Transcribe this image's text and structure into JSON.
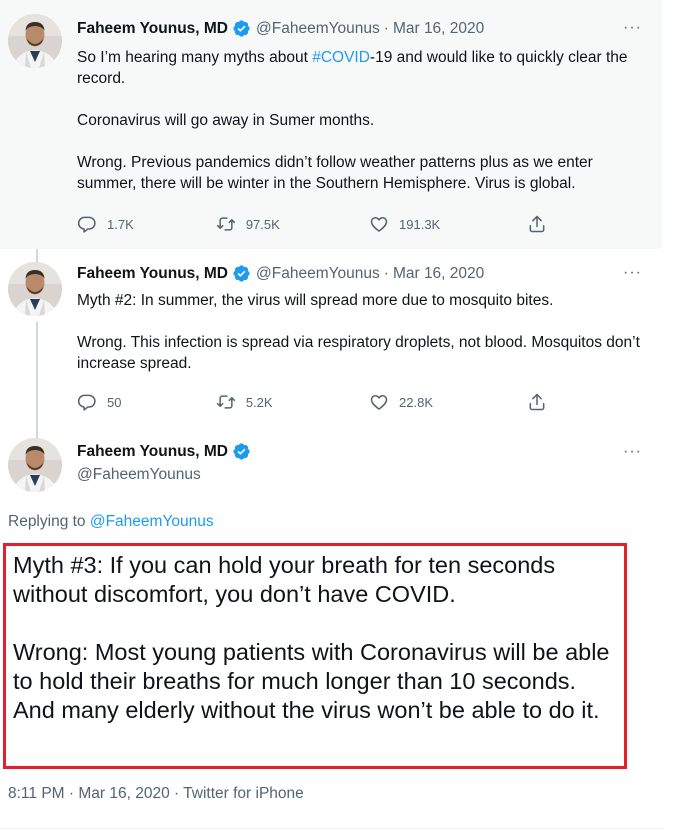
{
  "tweets": [
    {
      "name": "Faheem Younus, MD",
      "handle": "@FaheemYounus",
      "date": "Mar 16, 2020",
      "text_line1_pre": "So I’m hearing many myths about ",
      "hashtag": "#COVID",
      "text_line1_post": "-19 and would like to quickly clear the record.",
      "para2": "Coronavirus will go away in Sumer months.",
      "para3": "Wrong. Previous pandemics didn’t follow weather patterns plus as we enter summer, there will be winter in the Southern Hemisphere. Virus is global.",
      "replies": "1.7K",
      "retweets": "97.5K",
      "likes": "191.3K"
    },
    {
      "name": "Faheem Younus, MD",
      "handle": "@FaheemYounus",
      "date": "Mar 16, 2020",
      "para1": "Myth #2: In summer, the virus will spread more due to mosquito bites.",
      "para2": "Wrong. This infection is spread via respiratory droplets, not blood. Mosquitos don’t increase spread.",
      "replies": "50",
      "retweets": "5.2K",
      "likes": "22.8K"
    }
  ],
  "main": {
    "name": "Faheem Younus, MD",
    "handle": "@FaheemYounus",
    "replying_prefix": "Replying to ",
    "replying_handle": "@FaheemYounus",
    "para1": "Myth #3: If you can hold your breath for ten seconds without discomfort, you don’t have COVID.",
    "para2": "Wrong: Most young patients with Coronavirus will be able to hold their breaths for much longer than 10 seconds. And many elderly without the virus won’t be able to do it.",
    "meta": "8:11 PM · Mar 16, 2020 · Twitter for iPhone"
  },
  "ui": {
    "dot_separator": "·",
    "more_glyph": "···"
  },
  "colors": {
    "accent": "#1d9bf0",
    "highlight_border": "#e0202b",
    "muted": "#536471"
  },
  "icons": [
    "verified-badge-icon",
    "reply-icon",
    "retweet-icon",
    "like-icon",
    "share-icon",
    "more-icon"
  ]
}
